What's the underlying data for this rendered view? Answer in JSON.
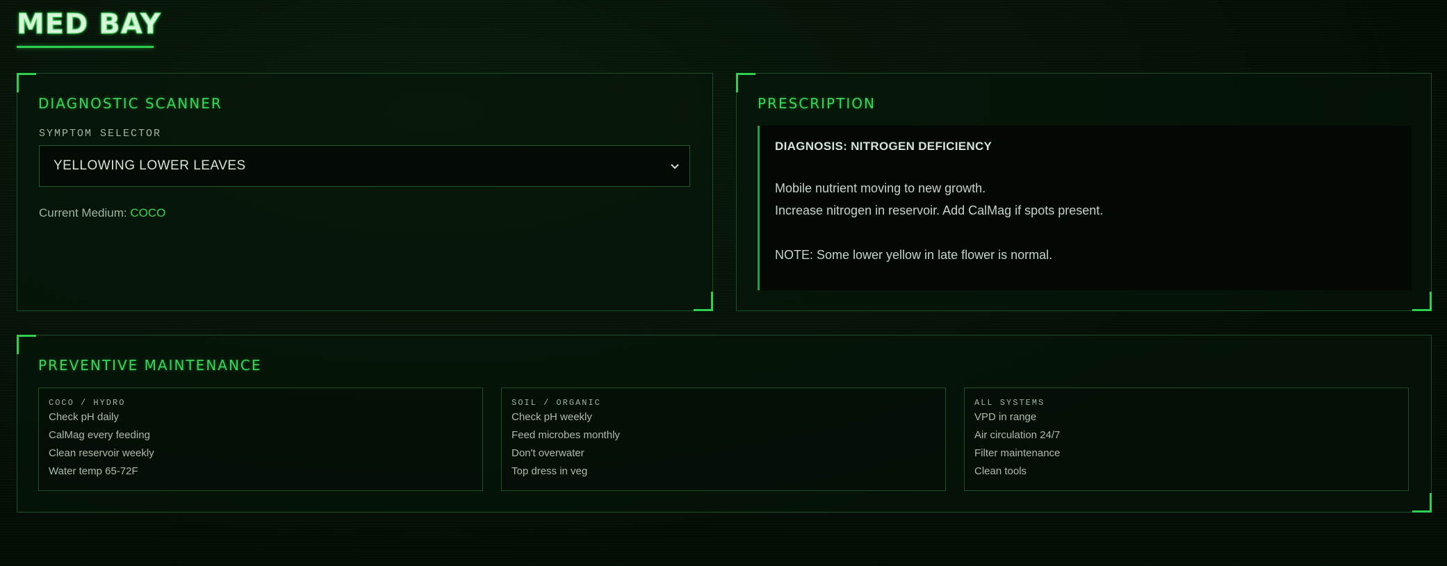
{
  "page": {
    "title": "MED BAY"
  },
  "scanner": {
    "title": "DIAGNOSTIC SCANNER",
    "symptom_label": "SYMPTOM SELECTOR",
    "symptom_value": "YELLOWING LOWER LEAVES",
    "medium_label": "Current Medium: ",
    "medium_value": "COCO"
  },
  "prescription": {
    "title": "PRESCRIPTION",
    "diagnosis": "DIAGNOSIS: NITROGEN DEFICIENCY",
    "line1": "Mobile nutrient moving to new growth.",
    "line2": "Increase nitrogen in reservoir. Add CalMag if spots present.",
    "note": "NOTE: Some lower yellow in late flower is normal."
  },
  "maintenance": {
    "title": "PREVENTIVE MAINTENANCE",
    "columns": [
      {
        "title": "COCO / HYDRO",
        "items": [
          "Check pH daily",
          "CalMag every feeding",
          "Clean reservoir weekly",
          "Water temp 65-72F"
        ]
      },
      {
        "title": "SOIL / ORGANIC",
        "items": [
          "Check pH weekly",
          "Feed microbes monthly",
          "Don't overwater",
          "Top dress in veg"
        ]
      },
      {
        "title": "ALL SYSTEMS",
        "items": [
          "VPD in range",
          "Air circulation 24/7",
          "Filter maintenance",
          "Clean tools"
        ]
      }
    ]
  },
  "colors": {
    "accent": "#2ed14f",
    "border": "#18502a",
    "background": "#061107"
  }
}
